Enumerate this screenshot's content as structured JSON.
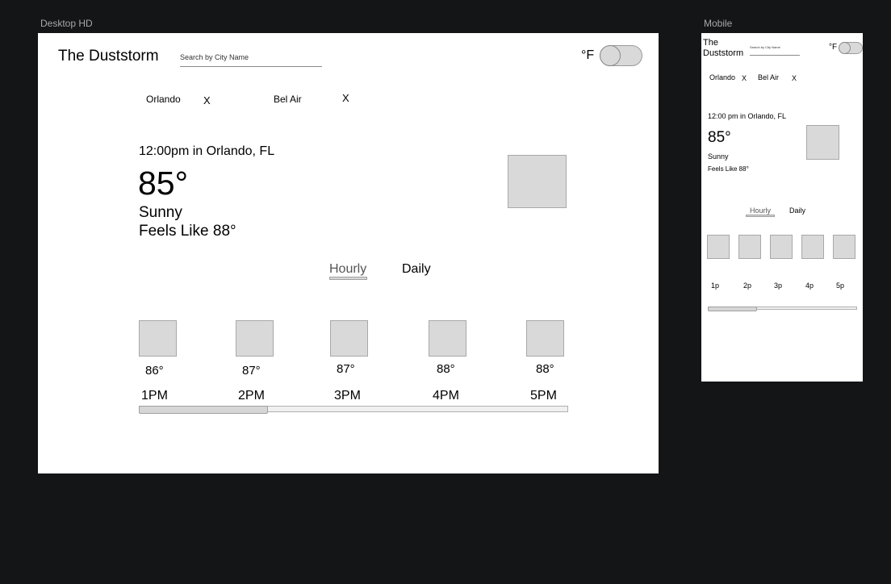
{
  "frames": {
    "desktop_label": "Desktop HD",
    "mobile_label": "Mobile"
  },
  "desktop": {
    "app_title": "The Duststorm",
    "search": {
      "placeholder": "Search by City Name",
      "value": ""
    },
    "unit_label": "°F",
    "saved_cities": [
      {
        "name": "Orlando",
        "remove": "X"
      },
      {
        "name": "Bel Air",
        "remove": "X"
      }
    ],
    "current": {
      "time_location": "12:00pm in Orlando, FL",
      "temperature": "85°",
      "condition": "Sunny",
      "feels_like": "Feels Like 88°"
    },
    "tabs": {
      "hourly": "Hourly",
      "daily": "Daily",
      "active": "hourly"
    },
    "hourly": [
      {
        "temp": "86°",
        "time": "1PM"
      },
      {
        "temp": "87°",
        "time": "2PM"
      },
      {
        "temp": "87°",
        "time": "3PM"
      },
      {
        "temp": "88°",
        "time": "4PM"
      },
      {
        "temp": "88°",
        "time": "5PM"
      }
    ],
    "scroll_fraction": 0.3
  },
  "mobile": {
    "app_title_line1": "The",
    "app_title_line2": "Duststorm",
    "search": {
      "placeholder": "Search by City Name",
      "value": ""
    },
    "unit_label": "°F",
    "saved_cities": [
      {
        "name": "Orlando",
        "remove": "X"
      },
      {
        "name": "Bel Air",
        "remove": "X"
      }
    ],
    "current": {
      "time_location": "12:00 pm in Orlando, FL",
      "temperature": "85°",
      "condition": "Sunny",
      "feels_like": "Feels Like 88°"
    },
    "tabs": {
      "hourly": "Hourly",
      "daily": "Daily",
      "active": "hourly"
    },
    "hourly": [
      {
        "time": "1p"
      },
      {
        "time": "2p"
      },
      {
        "time": "3p"
      },
      {
        "time": "4p"
      },
      {
        "time": "5p"
      }
    ],
    "scroll_fraction": 0.33
  }
}
